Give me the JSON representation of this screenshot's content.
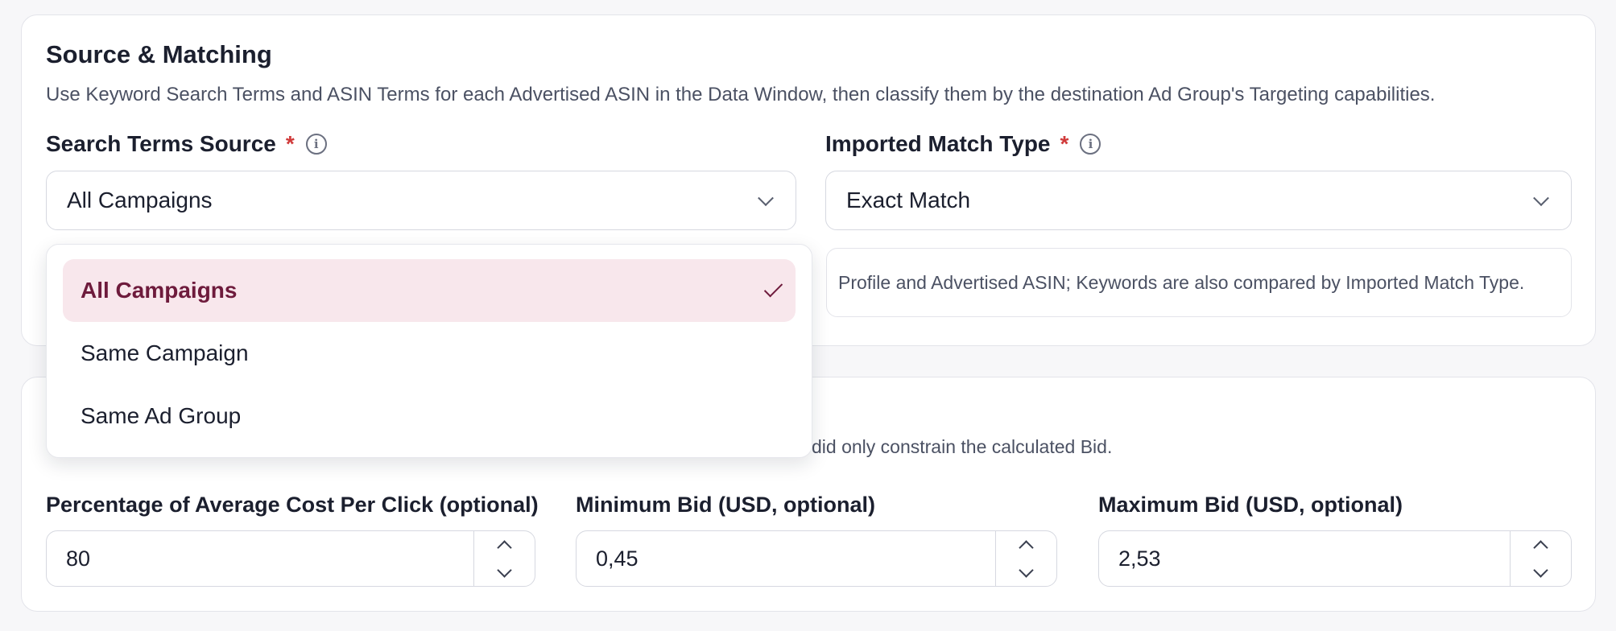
{
  "source_matching": {
    "title": "Source & Matching",
    "description": "Use Keyword Search Terms and ASIN Terms for each Advertised ASIN in the Data Window, then classify them by the destination Ad Group's Targeting capabilities.",
    "search_terms_source": {
      "label": "Search Terms Source",
      "required_mark": "*",
      "info_icon": "info-icon",
      "value": "All Campaigns",
      "options": [
        "All Campaigns",
        "Same Campaign",
        "Same Ad Group"
      ],
      "selected_index": 0
    },
    "imported_match_type": {
      "label": "Imported Match Type",
      "required_mark": "*",
      "info_icon": "info-icon",
      "value": "Exact Match",
      "note": "Profile and Advertised ASIN; Keywords are also compared by Imported Match Type."
    }
  },
  "bids": {
    "description_fragment": "did only constrain the calculated Bid.",
    "percentage_avg_cpc": {
      "label": "Percentage of Average Cost Per Click (optional)",
      "value": "80"
    },
    "min_bid": {
      "label": "Minimum Bid (USD, optional)",
      "value": "0,45"
    },
    "max_bid": {
      "label": "Maximum Bid (USD, optional)",
      "value": "2,53"
    }
  },
  "colors": {
    "accent_selected_bg": "#f8e7ec",
    "accent_selected_text": "#6e1b3c",
    "required": "#d03a3a"
  }
}
